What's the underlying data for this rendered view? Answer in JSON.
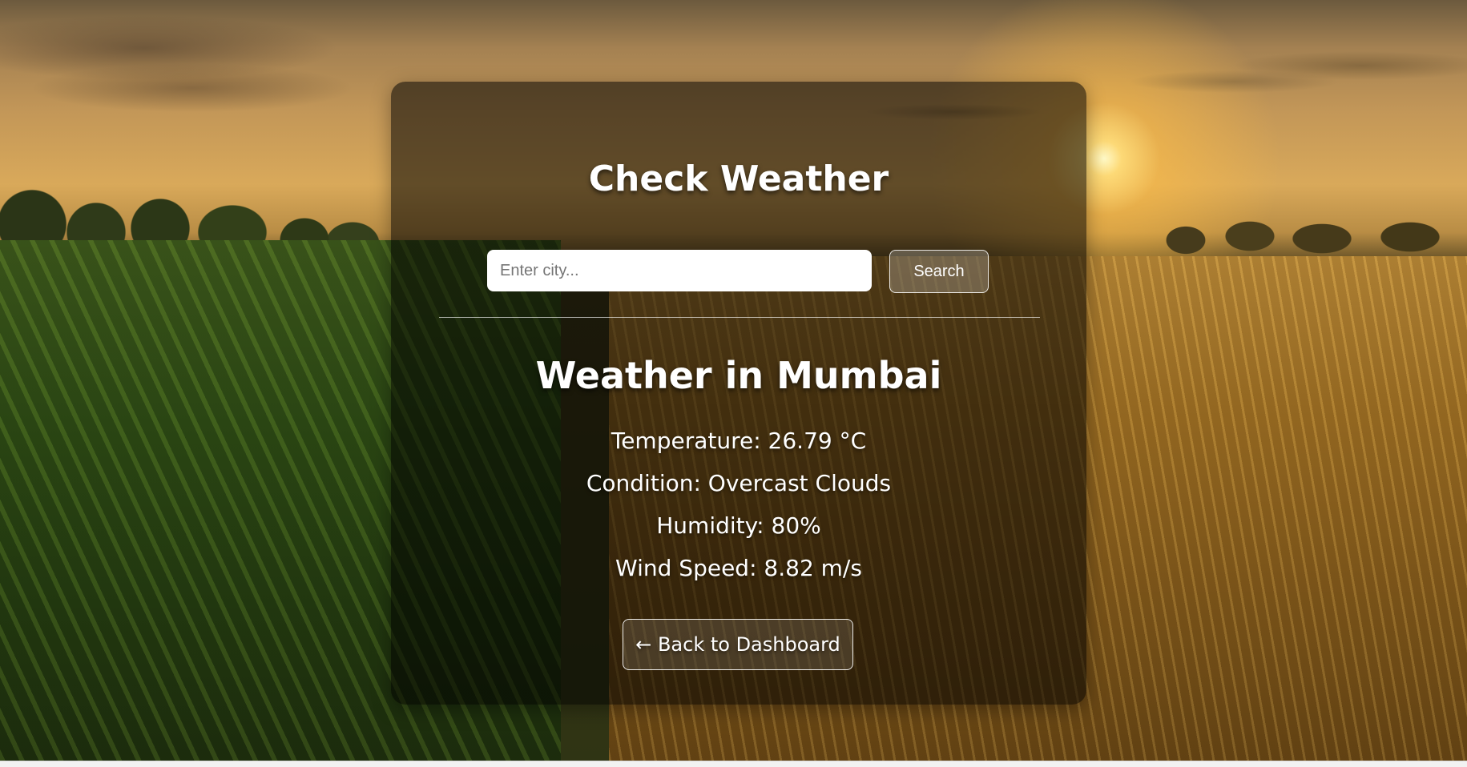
{
  "weather_card": {
    "title": "Check Weather",
    "search": {
      "placeholder": "Enter city...",
      "value": "",
      "button_label": "Search"
    },
    "result": {
      "heading": "Weather in Mumbai",
      "temperature": "Temperature: 26.79 °C",
      "condition": "Condition: Overcast Clouds",
      "humidity": "Humidity: 80%",
      "wind_speed": "Wind Speed: 8.82 m/s"
    },
    "back_button_label": "← Back to Dashboard"
  },
  "colors": {
    "card_background": "rgba(0,0,0,0.55)",
    "text": "#ffffff",
    "input_background": "#ffffff"
  }
}
